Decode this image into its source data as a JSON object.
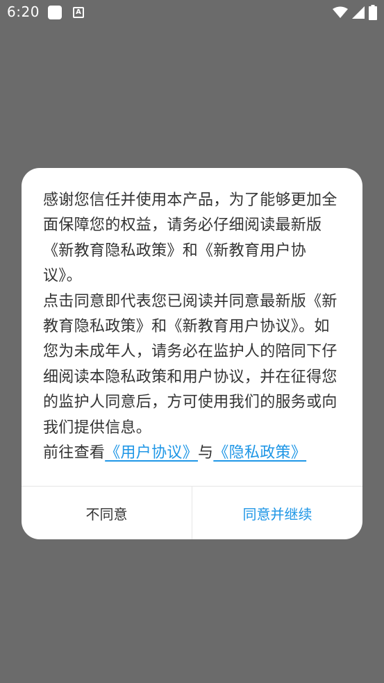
{
  "status_bar": {
    "time": "6:20",
    "notification_letter": "A",
    "icons": [
      "wifi-icon",
      "signal-icon",
      "battery-icon"
    ]
  },
  "dialog": {
    "paragraph1": "感谢您信任并使用本产品，为了能够更加全面保障您的权益，请务必仔细阅读最新版《新教育隐私政策》和《新教育用户协议》。",
    "paragraph2": " 点击同意即代表您已阅读并同意最新版《新教育隐私政策》和《新教育用户协议》。如您为未成年人，请务必在监护人的陪同下仔细阅读本隐私政策和用户协议，并在征得您的监护人同意后，方可使用我们的服务或向我们提供信息。",
    "links_prefix": " 前往查看",
    "link_user_agreement": "《用户协议》",
    "links_separator": "与",
    "link_privacy_policy": "《隐私政策》",
    "disagree_label": "不同意",
    "agree_label": "同意并继续"
  },
  "colors": {
    "overlay": "#6b6b6b",
    "link": "#1e96e6",
    "text": "#333333",
    "dialog_background": "#ffffff"
  }
}
